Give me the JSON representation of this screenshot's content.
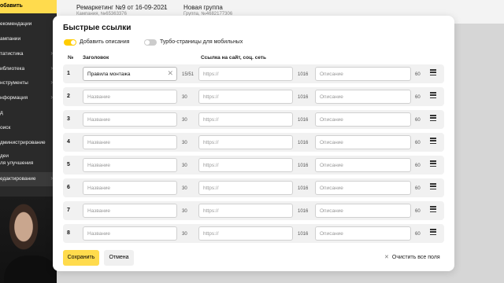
{
  "sidebar": {
    "add_label": "обавить",
    "items": [
      {
        "label": "екомендации",
        "chevron": false
      },
      {
        "label": "ампании",
        "chevron": false
      },
      {
        "label": "татистика",
        "chevron": true
      },
      {
        "label": "иблиотека",
        "chevron": true
      },
      {
        "label": "нструменты",
        "chevron": true
      },
      {
        "label": "нформация",
        "chevron": true
      },
      {
        "label": "д",
        "chevron": false
      },
      {
        "label": "оиск",
        "chevron": false
      },
      {
        "label": "дминистрирование",
        "chevron": false
      },
      {
        "label": "деи\nля улучшения",
        "chevron": false
      },
      {
        "label": "едактирование",
        "chevron": true
      }
    ]
  },
  "header": {
    "crumb1_title": "Ремаркетинг №9 от 16-09-2021",
    "crumb1_sub": "Кампания, №65363376",
    "crumb2_title": "Новая группа",
    "crumb2_sub": "Группа, №4682177306"
  },
  "modal": {
    "title": "Быстрые ссылки",
    "toggle_descriptions": {
      "label": "Добавить описания",
      "on": true
    },
    "toggle_turbo": {
      "label": "Турбо-страницы для мобильных",
      "on": false
    },
    "columns": {
      "num": "№",
      "title": "Заголовок",
      "url": "Ссылка на сайт, соц. сеть"
    },
    "placeholders": {
      "title": "Название",
      "url": "https://",
      "desc": "Описание"
    },
    "rows": [
      {
        "num": "1",
        "title": "Правила монтажа",
        "title_count": "15/51",
        "url": "",
        "url_count": "1016",
        "desc": "",
        "desc_count": "60"
      },
      {
        "num": "2",
        "title": "",
        "title_count": "30",
        "url": "",
        "url_count": "1016",
        "desc": "",
        "desc_count": "60"
      },
      {
        "num": "3",
        "title": "",
        "title_count": "30",
        "url": "",
        "url_count": "1016",
        "desc": "",
        "desc_count": "60"
      },
      {
        "num": "4",
        "title": "",
        "title_count": "30",
        "url": "",
        "url_count": "1016",
        "desc": "",
        "desc_count": "60"
      },
      {
        "num": "5",
        "title": "",
        "title_count": "30",
        "url": "",
        "url_count": "1016",
        "desc": "",
        "desc_count": "60"
      },
      {
        "num": "6",
        "title": "",
        "title_count": "30",
        "url": "",
        "url_count": "1016",
        "desc": "",
        "desc_count": "60"
      },
      {
        "num": "7",
        "title": "",
        "title_count": "30",
        "url": "",
        "url_count": "1016",
        "desc": "",
        "desc_count": "60"
      },
      {
        "num": "8",
        "title": "",
        "title_count": "30",
        "url": "",
        "url_count": "1016",
        "desc": "",
        "desc_count": "60"
      }
    ],
    "save_label": "Сохранить",
    "cancel_label": "Отмена",
    "clear_all_label": "Очистить все поля"
  },
  "colors": {
    "accent": "#ffdb4d",
    "sidebar_bg": "#2a2a2a"
  }
}
